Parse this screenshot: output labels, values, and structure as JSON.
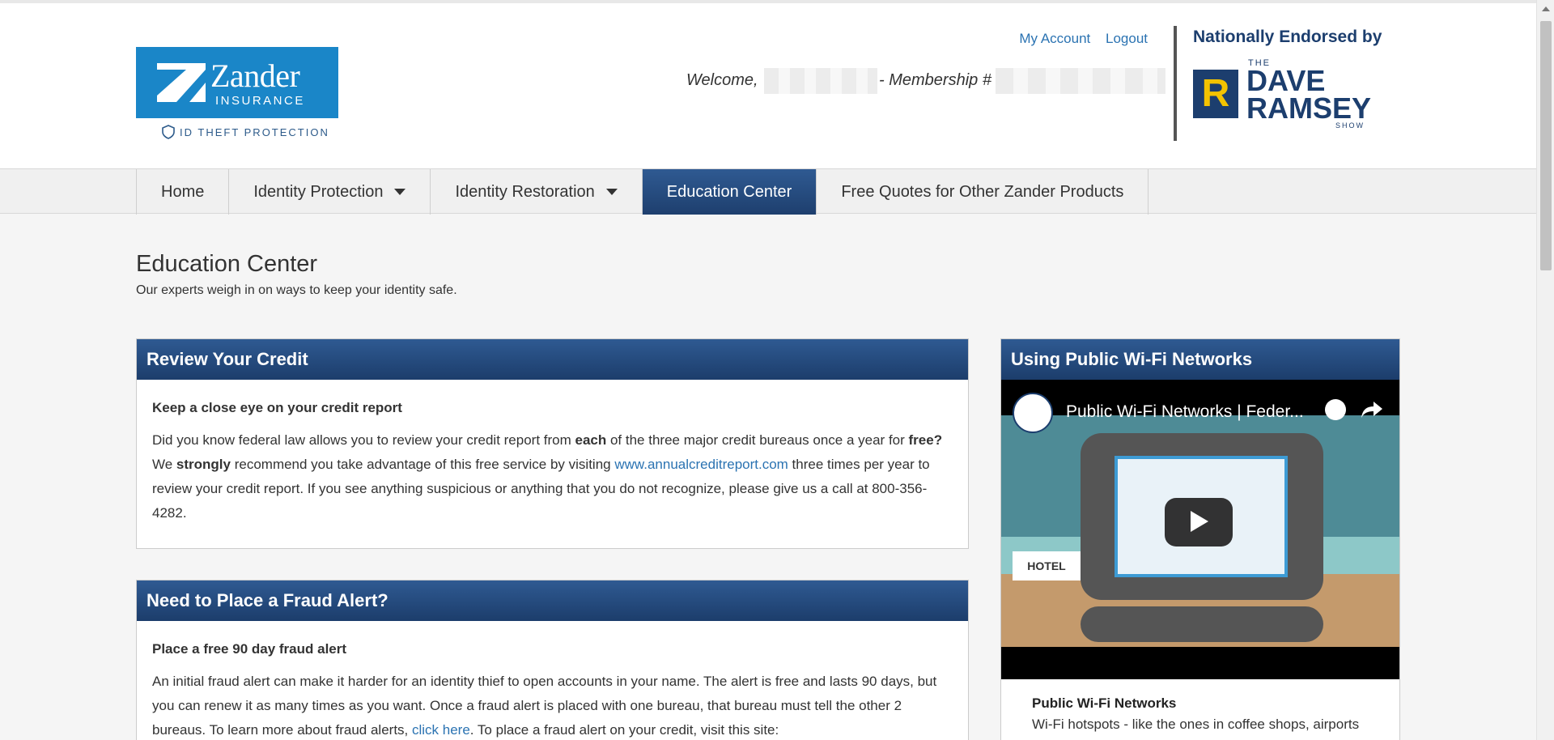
{
  "header": {
    "logo_title": "Zander",
    "logo_sub": "INSURANCE",
    "idtheft": "ID THEFT PROTECTION",
    "links": [
      "My Account",
      "Logout"
    ],
    "welcome": "Welcome,",
    "membership": "- Membership #",
    "endorsed": "Nationally Endorsed by",
    "dave_the": "THE",
    "dave": "DAVE",
    "ramsey": "RAMSEY",
    "show": "SHOW",
    "r_logo": "R"
  },
  "nav": {
    "items": [
      {
        "label": "Home"
      },
      {
        "label": "Identity Protection"
      },
      {
        "label": "Identity Restoration"
      },
      {
        "label": "Education Center"
      },
      {
        "label": "Free Quotes for Other Zander Products"
      }
    ]
  },
  "page": {
    "title": "Education Center",
    "subtitle": "Our experts weigh in on ways to keep your identity safe."
  },
  "panels": {
    "credit": {
      "title": "Review Your Credit",
      "heading": "Keep a close eye on your credit report",
      "text_1": "Did you know federal law allows you to review your credit report from ",
      "bold_1": "each",
      "text_2": " of the three major credit bureaus once a year for ",
      "bold_2": "free?",
      "text_3": " We ",
      "bold_3": "strongly",
      "text_4": " recommend you take advantage of this free service by visiting ",
      "link": "www.annualcreditreport.com",
      "text_5": " three times per year to review your credit report. If you see anything suspicious or anything that you do not recognize, please give us a call at 800-356-4282."
    },
    "fraud": {
      "title": "Need to Place a Fraud Alert?",
      "heading": "Place a free 90 day fraud alert",
      "text_1": "An initial fraud alert can make it harder for an identity thief to open accounts in your name. The alert is free and lasts 90 days, but you can renew it as many times as you want. Once a fraud alert is placed with one bureau, that bureau must tell the other 2 bureaus. To learn more about fraud alerts, ",
      "link": "click here",
      "text_2": ". To place a fraud alert on your credit, visit this site:"
    },
    "wifi": {
      "title": "Using Public Wi-Fi Networks",
      "video_title": "Public Wi-Fi Networks | Feder...",
      "hotel_sign": "HOTEL",
      "caption_title": "Public Wi-Fi Networks",
      "caption": "Wi-Fi hotspots - like the ones in coffee shops, airports"
    }
  },
  "colors": {
    "nav_active": "#1e3f6e",
    "panel_header": "#2f5a92",
    "link": "#2b73b2",
    "logo_bg": "#1a86c8"
  }
}
